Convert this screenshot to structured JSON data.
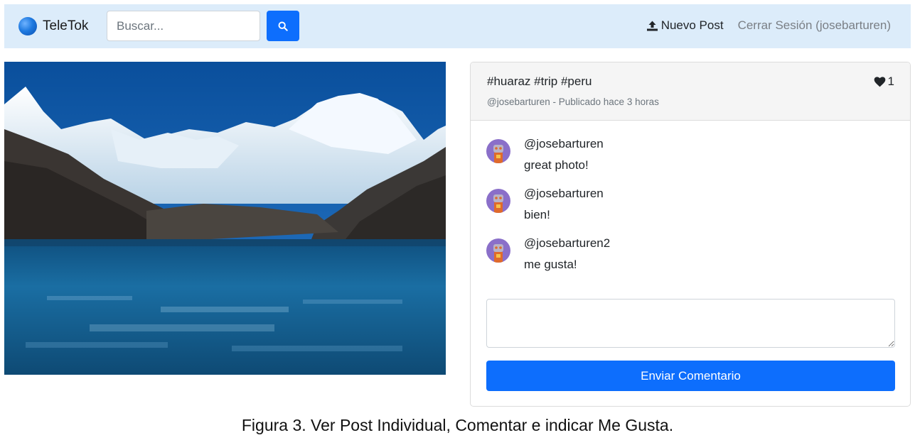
{
  "navbar": {
    "brand": "TeleTok",
    "brand_logo": "globe-icon",
    "search": {
      "placeholder": "Buscar...",
      "value": "",
      "button_icon": "search-icon"
    },
    "new_post_label": "Nuevo Post",
    "new_post_icon": "upload-icon",
    "logout_label": "Cerrar Sesión (josebarturen)"
  },
  "post": {
    "image": "mountain-lake-photo",
    "tags": "#huaraz #trip #peru",
    "meta": "@josebarturen - Publicado hace 3 horas",
    "likes": "1",
    "like_icon": "heart-icon"
  },
  "comments": [
    {
      "user": "@josebarturen",
      "text": "great photo!",
      "avatar": "robot-avatar"
    },
    {
      "user": "@josebarturen",
      "text": "bien!",
      "avatar": "robot-avatar"
    },
    {
      "user": "@josebarturen2",
      "text": "me gusta!",
      "avatar": "robot-avatar"
    }
  ],
  "comment_form": {
    "value": "",
    "submit_label": "Enviar Comentario"
  },
  "caption": "Figura 3. Ver Post Individual, Comentar e indicar Me Gusta.",
  "colors": {
    "navbar": "#dcecfa",
    "primary": "#0d6efd",
    "card_header": "#f5f5f5"
  }
}
